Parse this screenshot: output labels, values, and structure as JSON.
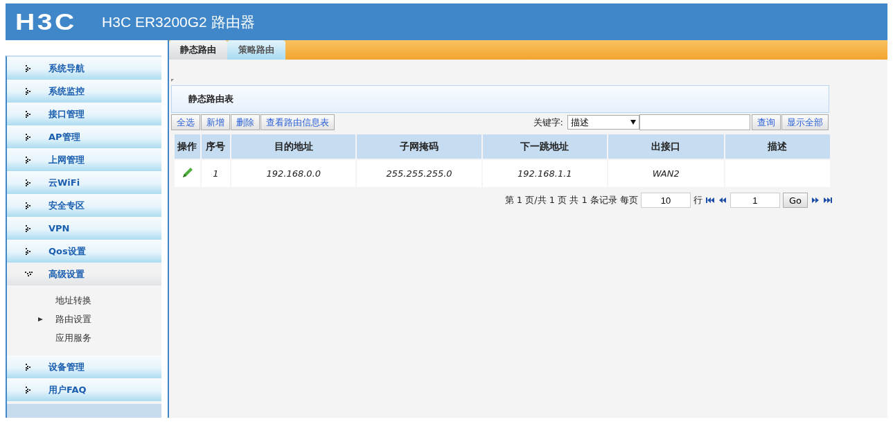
{
  "header": {
    "logo": "H3C",
    "title": "H3C ER3200G2 路由器"
  },
  "tabs": [
    {
      "label": "静态路由",
      "selected": true
    },
    {
      "label": "策略路由",
      "selected": false
    }
  ],
  "sidebar": {
    "items": [
      {
        "label": "系统导航",
        "expanded": false
      },
      {
        "label": "系统监控",
        "expanded": false
      },
      {
        "label": "接口管理",
        "expanded": false
      },
      {
        "label": "AP管理",
        "expanded": false
      },
      {
        "label": "上网管理",
        "expanded": false
      },
      {
        "label": "云WiFi",
        "expanded": false
      },
      {
        "label": "安全专区",
        "expanded": false
      },
      {
        "label": "VPN",
        "expanded": false
      },
      {
        "label": "Qos设置",
        "expanded": false
      },
      {
        "label": "高级设置",
        "expanded": true,
        "children": [
          {
            "label": "地址转换",
            "selected": false
          },
          {
            "label": "路由设置",
            "selected": true
          },
          {
            "label": "应用服务",
            "selected": false
          }
        ]
      },
      {
        "label": "设备管理",
        "expanded": false
      },
      {
        "label": "用户FAQ",
        "expanded": false
      }
    ]
  },
  "panel": {
    "title": "静态路由表",
    "toolbar": [
      "全选",
      "新增",
      "删除",
      "查看路由信息表"
    ],
    "search": {
      "label": "关键字:",
      "field": "描述",
      "buttons": [
        "查询",
        "显示全部"
      ]
    },
    "table": {
      "columns": [
        "操作",
        "序号",
        "目的地址",
        "子网掩码",
        "下一跳地址",
        "出接口",
        "描述"
      ],
      "rows": [
        {
          "index": "1",
          "destination": "192.168.0.0",
          "mask": "255.255.255.0",
          "next_hop": "192.168.1.1",
          "interface": "WAN2"
        }
      ]
    },
    "pagination": {
      "summary": "第 1 页/共 1 页 共 1 条记录 每页",
      "per_page": "10",
      "rows_label": "行",
      "page": "1",
      "go": "Go"
    }
  }
}
